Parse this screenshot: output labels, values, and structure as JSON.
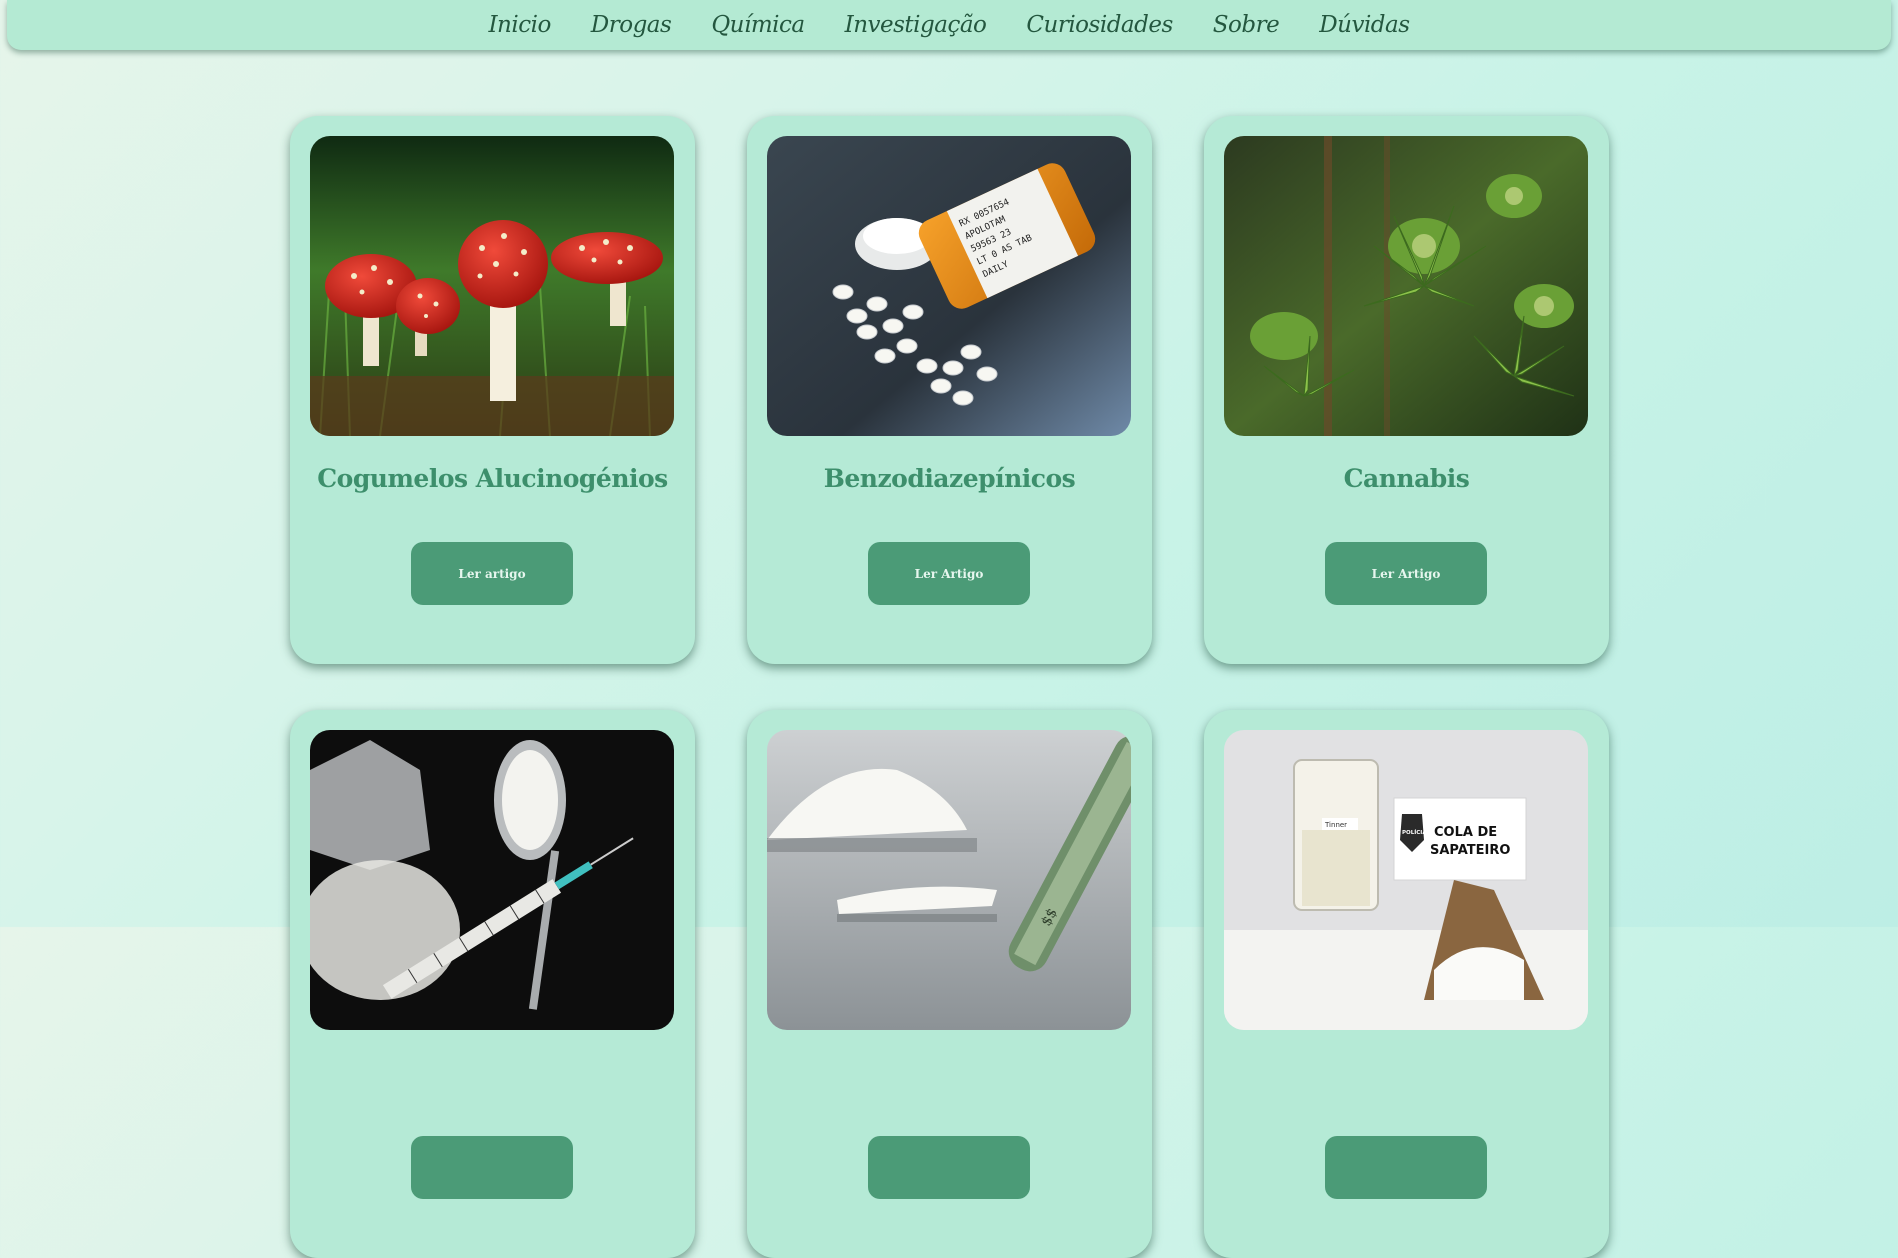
{
  "nav": {
    "items": [
      {
        "label": "Inicio"
      },
      {
        "label": "Drogas"
      },
      {
        "label": "Química"
      },
      {
        "label": "Investigação"
      },
      {
        "label": "Curiosidades"
      },
      {
        "label": "Sobre"
      },
      {
        "label": "Dúvidas"
      }
    ]
  },
  "cards": [
    {
      "title": "Cogumelos Alucinogénios",
      "button": "Ler artigo"
    },
    {
      "title": "Benzodiazepínicos",
      "button": "Ler Artigo"
    },
    {
      "title": "Cannabis",
      "button": "Ler Artigo"
    },
    {
      "title": "",
      "button": ""
    },
    {
      "title": "",
      "button": ""
    },
    {
      "title": "",
      "button": ""
    }
  ],
  "images": {
    "pill_label_lines": [
      "RX 0057654",
      "APOLOTAM",
      "59563 23",
      "LT 0 AS TAB",
      "DAILY"
    ],
    "glue_sign": [
      "COLA DE",
      "SAPATEIRO"
    ],
    "glue_badge": "POLÍCIA",
    "beaker_label": "Tinner"
  },
  "colors": {
    "nav_bg": "#b4ead3",
    "card_bg": "#b5ead6",
    "accent": "#4b9b77",
    "title_text": "#3d8f6c",
    "nav_text": "#24573f"
  }
}
